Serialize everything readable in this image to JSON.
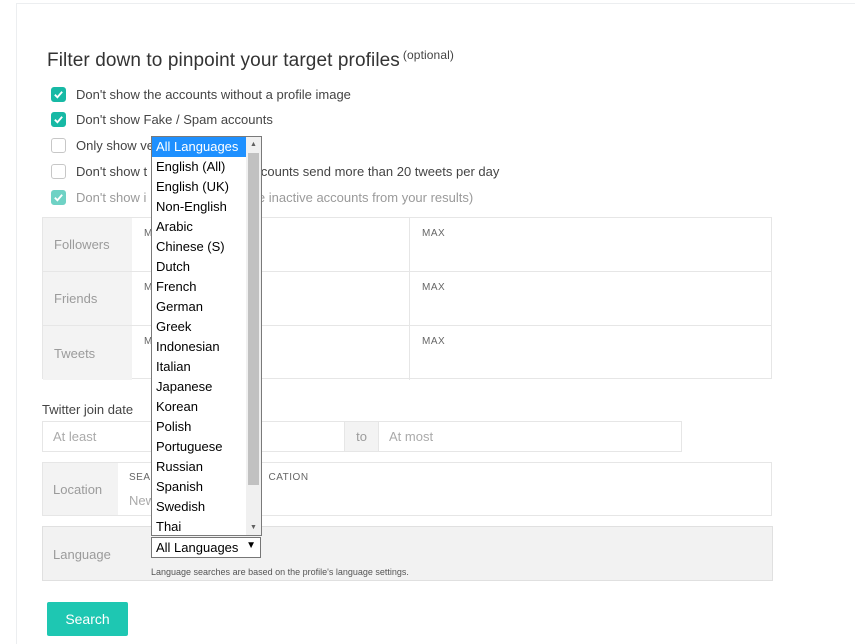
{
  "filter": {
    "title": "Filter down to pinpoint your target profiles",
    "optional": "(optional)"
  },
  "checkboxes": [
    {
      "label": "Don't show the accounts without a profile image",
      "checked": true
    },
    {
      "label": "Don't show Fake / Spam accounts",
      "checked": true
    },
    {
      "label": "Only show ve",
      "checked": false
    },
    {
      "label": "Don't show t",
      "label_tail": "accounts send more than 20 tweets per day",
      "checked": false
    },
    {
      "label": "Don't show i",
      "label_tail": "ve inactive accounts from your results)",
      "checked": true,
      "disabled": true
    }
  ],
  "ranges": [
    {
      "label": "Followers",
      "min": "M",
      "max": "MAX"
    },
    {
      "label": "Friends",
      "min": "M",
      "max": "MAX"
    },
    {
      "label": "Tweets",
      "min": "M",
      "max": "MAX"
    }
  ],
  "join_date": {
    "label": "Twitter join date",
    "from_placeholder": "At least",
    "to": "to",
    "to_placeholder": "At most"
  },
  "location": {
    "label": "Location",
    "head_left": "SEA",
    "head_right": "CATION",
    "placeholder": "New"
  },
  "language": {
    "label": "Language",
    "selected": "All Languages",
    "note": "Language searches are based on the profile's language settings.",
    "options": [
      "All Languages",
      "English (All)",
      "English (UK)",
      "Non-English",
      "Arabic",
      "Chinese (S)",
      "Dutch",
      "French",
      "German",
      "Greek",
      "Indonesian",
      "Italian",
      "Japanese",
      "Korean",
      "Polish",
      "Portuguese",
      "Russian",
      "Spanish",
      "Swedish",
      "Thai"
    ]
  },
  "search_button": "Search",
  "colors": {
    "accent": "#1ec7b2",
    "checkbox": "#17b9a5",
    "highlight": "#1e90ff"
  }
}
